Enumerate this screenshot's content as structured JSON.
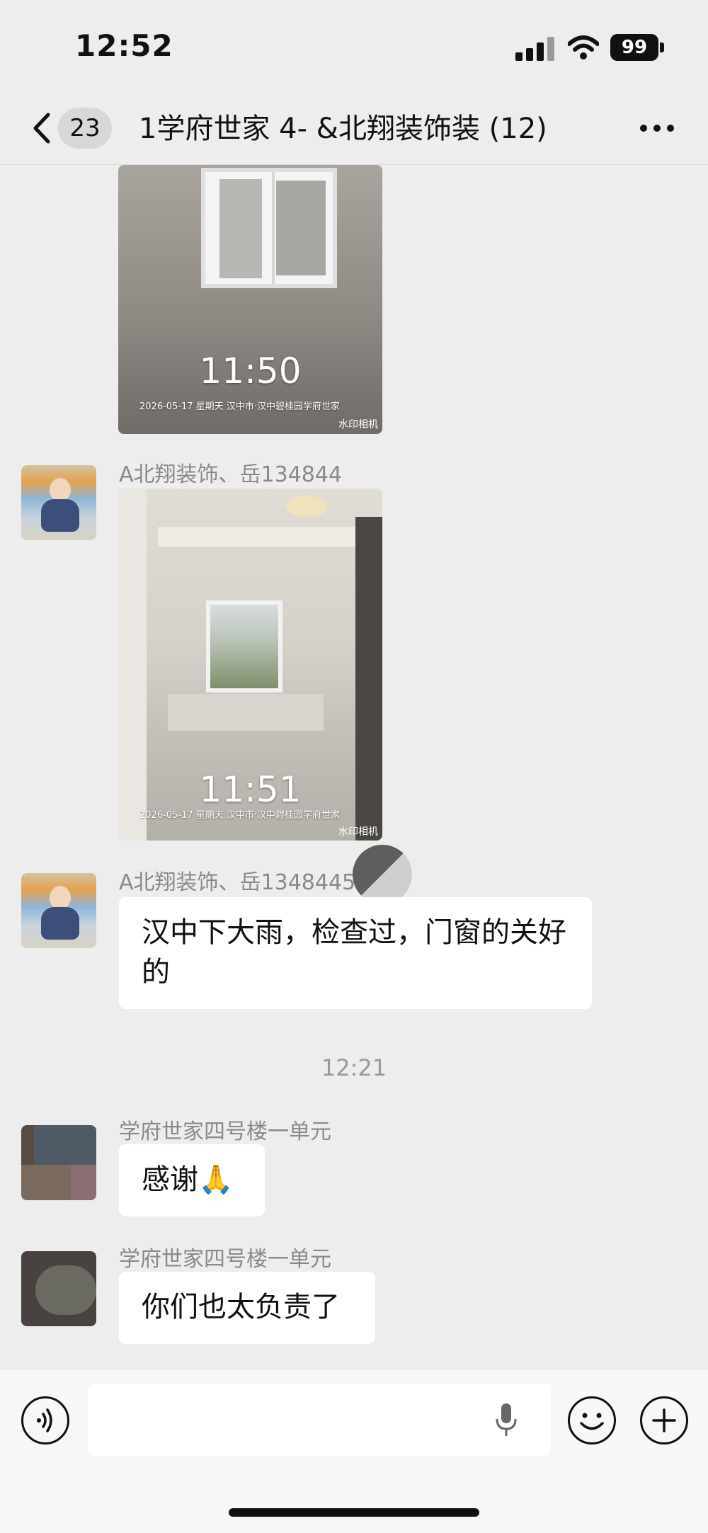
{
  "status_bar": {
    "time": "12:52",
    "battery": "99",
    "icons": [
      "signal-icon",
      "wifi-icon",
      "battery-icon"
    ]
  },
  "nav": {
    "unread_count": "23",
    "title": "1学府世家 4-        &北翔装饰装 (12)"
  },
  "messages": {
    "m1": {
      "type": "image",
      "photo_time": "11:50",
      "caption": "2026-05-17 星期天  汉中市·汉中碧桂园学府世家",
      "brand": "水印相机"
    },
    "m2": {
      "sender": "A北翔装饰、岳134844",
      "type": "image",
      "photo_time": "11:51",
      "caption": "2026-05-17 星期天  汉中市·汉中碧桂园学府世家",
      "brand": "水印相机"
    },
    "m3": {
      "sender": "A北翔装饰、岳1348445",
      "text": "汉中下大雨，检查过，门窗的关好的"
    },
    "divider": "12:21",
    "m4": {
      "sender": "学府世家四号楼一单元",
      "text": "感谢🙏"
    },
    "m5": {
      "sender": "学府世家四号楼一单元",
      "text": "你们也太负责了"
    }
  },
  "input_bar": {
    "placeholder": "",
    "icons": [
      "voice-icon",
      "mic-icon",
      "emoji-icon",
      "plus-icon"
    ]
  }
}
